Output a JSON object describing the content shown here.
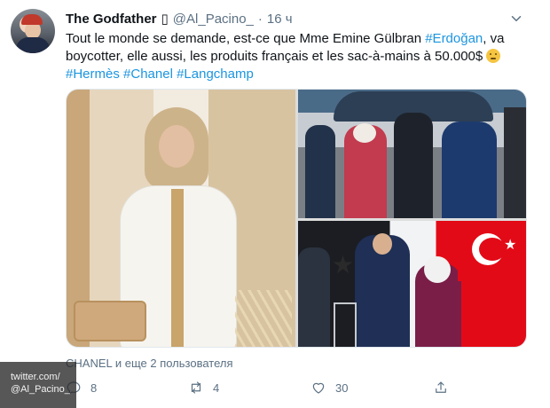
{
  "tweet": {
    "author_name": "The Godfather",
    "name_badge": "▯",
    "handle": "@Al_Pacino_",
    "separator": "·",
    "time": "16 ч",
    "text_part1": "Tout le monde se demande, est-ce que Mme Emine Gülbran ",
    "mention": "#Erdoğan",
    "text_part2": ", va boycotter, elle aussi, les produits français et les sac-à-mains à 50.000$",
    "emoji": "thinking-face",
    "hashtags": [
      "#Hermès",
      "#Chanel",
      "#Langchamp"
    ],
    "likers": "CHANEL и еще 2 пользователя",
    "counts": {
      "reply": "8",
      "retweet": "4",
      "like": "30"
    }
  },
  "watermark": {
    "line1": "twitter.com/",
    "line2": "@Al_Pacino_"
  },
  "icons": {
    "more": "chevron-down-icon",
    "reply": "reply-icon",
    "retweet": "retweet-icon",
    "like": "heart-icon",
    "share": "share-icon"
  },
  "colors": {
    "accent": "#1b95e0",
    "muted": "#5b7083",
    "text": "#0f1419"
  }
}
